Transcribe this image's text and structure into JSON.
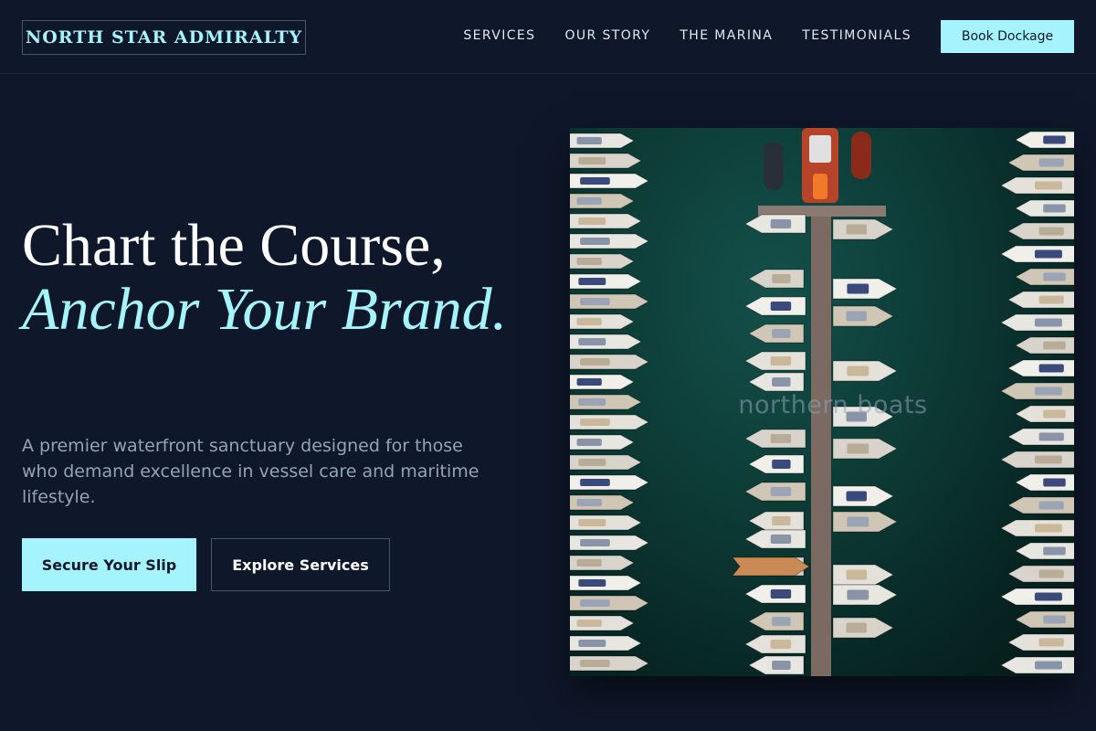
{
  "brand": {
    "name": "NORTH STAR ADMIRALTY"
  },
  "nav": {
    "links": [
      "SERVICES",
      "OUR STORY",
      "THE MARINA",
      "TESTIMONIALS"
    ],
    "cta": "Book Dockage"
  },
  "hero": {
    "title_line1": "Chart the Course,",
    "title_accent": "Anchor Your Brand.",
    "subtitle": "A premier waterfront sanctuary designed for those who demand excellence in vessel care and maritime lifestyle.",
    "primary_cta": "Secure Your Slip",
    "secondary_cta": "Explore Services"
  },
  "image": {
    "watermark": "northern boats"
  },
  "colors": {
    "background": "#0f172a",
    "accent": "#a5f3fc",
    "muted_text": "#94a3b8",
    "border": "#475569"
  }
}
